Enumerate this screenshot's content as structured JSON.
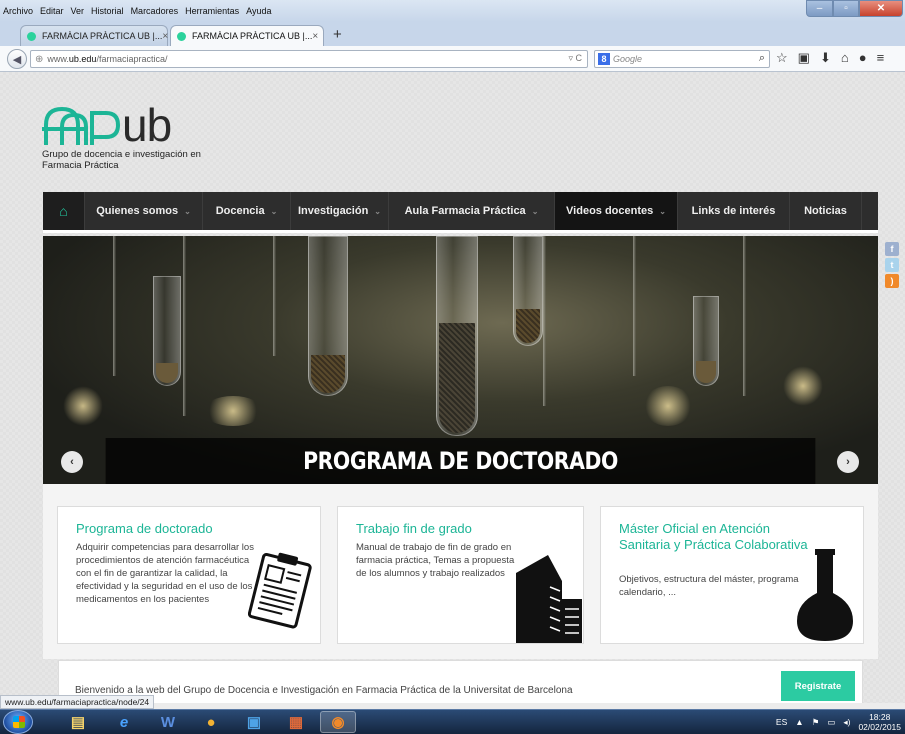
{
  "browser": {
    "menu": [
      "Archivo",
      "Editar",
      "Ver",
      "Historial",
      "Marcadores",
      "Herramientas",
      "Ayuda"
    ],
    "tabs": [
      {
        "label": "FARMÀCIA PRÀCTICA UB |...",
        "active": false
      },
      {
        "label": "FARMÀCIA PRÀCTICA UB |...",
        "active": true
      }
    ],
    "url_prefix": "www.",
    "url_host": "ub.edu",
    "url_path": "/farmaciapractica/",
    "search_engine": "Google",
    "search_placeholder": "Google",
    "status_text": "www.ub.edu/farmaciapractica/node/24"
  },
  "site": {
    "logo_text": "ub",
    "logo_color": "#1cb596",
    "subtitle": "Grupo de docencia e investigación en Farmacia Práctica",
    "nav": [
      {
        "label": "Quienes somos",
        "dropdown": true
      },
      {
        "label": "Docencia",
        "dropdown": true
      },
      {
        "label": "Investigación",
        "dropdown": true
      },
      {
        "label": "Aula Farmacia Práctica",
        "dropdown": true
      },
      {
        "label": "Videos docentes",
        "dropdown": true
      },
      {
        "label": "Links de interés",
        "dropdown": false
      },
      {
        "label": "Noticias",
        "dropdown": false
      }
    ],
    "slider_caption": "PROGRAMA DE DOCTORADO",
    "cards": [
      {
        "title": "Programa de doctorado",
        "body": "Adquirir competencias para desarrollar los procedimientos de atención farmacéutica con el fin de garantizar la calidad, la efectividad y la seguridad en el uso de los medicamentos en los pacientes",
        "icon": "clipboard-icon"
      },
      {
        "title": "Trabajo fin de grado",
        "body": "Manual de trabajo de fin de grado en farmacia práctica, Temas a propuesta de los alumnos y trabajo realizados",
        "icon": "building-icon"
      },
      {
        "title": "Máster Oficial en Atención Sanitaria y Práctica Colaborativa",
        "body": "Objetivos, estructura del máster, programa calendario, ...",
        "icon": "flask-icon"
      }
    ],
    "welcome_text": "Bienvenido a la web del Grupo de Docencia e Investigación en Farmacia Práctica de la Universitat de Barcelona",
    "register_label": "Registrate",
    "accent": "#2ccba2"
  },
  "taskbar": {
    "language": "ES",
    "time": "18:28",
    "date": "02/02/2015"
  }
}
